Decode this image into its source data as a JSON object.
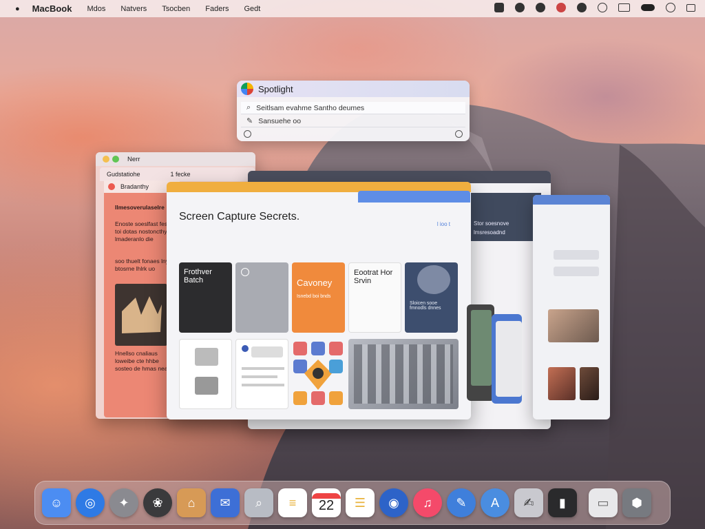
{
  "menubar": {
    "app_name": "MacBook",
    "apple_glyph": "●",
    "menus": [
      "Mdos",
      "Natvers",
      "Tsocben",
      "Faders",
      "Gedt"
    ],
    "status_icons": [
      "camera-icon",
      "compass-icon",
      "bird-icon",
      "user-icon",
      "globe-icon",
      "cloud-icon",
      "display-icon",
      "battery-icon",
      "wifi-icon",
      "control-center-icon"
    ]
  },
  "spotlight": {
    "title": "Spotlight",
    "search_value": "Seitlsam evahme Santho deumes",
    "suggestion": "Sansuehe oo"
  },
  "notes_window": {
    "title": "Nerr",
    "tab_left": "Gudstatiohe",
    "tab_right": "1 fecke",
    "subtitle": "Bradanthy",
    "heading": "Ilmesoverulaselre",
    "para1": "Enoste soeslfast fesclot toi dotas nostoncthy of lmaderanlo die",
    "para2": "soo thuelt fonaes lnyal btosrne lhlrk uo",
    "para3": "Hnellso cnaliaus loweibe cte hhbe sosteo de hmas neasio"
  },
  "dark_window": {
    "side_title": "Stor soesnove",
    "side_sub": "lmsresoadnd"
  },
  "main_window": {
    "title": "Screen Capture Secrets.",
    "link": "l ioo t",
    "cards": [
      {
        "title": "Frothver Batch",
        "sub": ""
      },
      {
        "title": "",
        "sub": ""
      },
      {
        "title": "Cavoney",
        "sub": "Isnebd boi bnds"
      },
      {
        "title": "Eootrat Hor Srvin",
        "sub": ""
      },
      {
        "title": "",
        "sub": "Sloicen sooe fmnodls dnnes"
      }
    ]
  },
  "dock": {
    "calendar_day": "22",
    "apps": [
      "finder-icon",
      "safari-icon",
      "launchpad-icon",
      "photos-icon",
      "home-icon",
      "mail-icon",
      "preview-icon",
      "notes-icon",
      "calendar-icon",
      "reminders-icon",
      "podcasts-icon",
      "music-icon",
      "pages-icon",
      "app-store-icon",
      "textedit-icon",
      "terminal-icon",
      "disk-icon",
      "trash-icon"
    ]
  },
  "colors": {
    "accent_orange": "#f0ae3f",
    "accent_blue": "#5b84d4",
    "notes_red": "#ec8774",
    "menubar_bg": "#f7eeee"
  }
}
